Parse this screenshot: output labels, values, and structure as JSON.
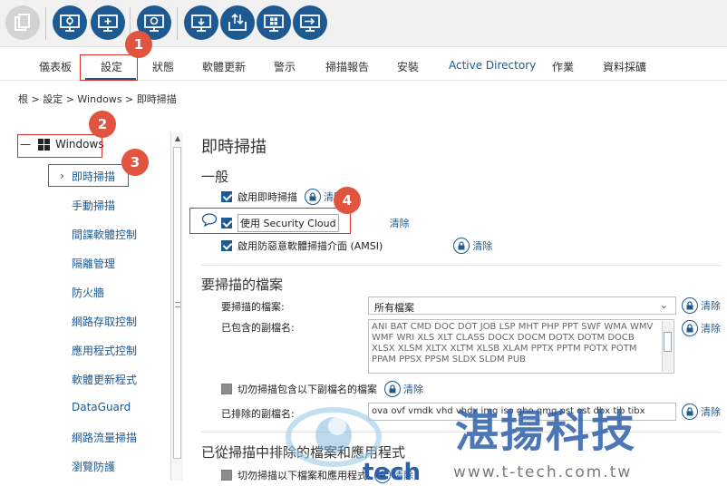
{
  "toolbar": {
    "buttons": [
      {
        "icon": "copy-icon",
        "enabled": false
      },
      {
        "icon": "monitor-settings-icon",
        "enabled": true
      },
      {
        "icon": "monitor-add-icon",
        "enabled": true
      },
      {
        "icon": "settings-monitor-icon",
        "enabled": true
      },
      {
        "icon": "monitor-download-icon",
        "enabled": true
      },
      {
        "icon": "monitor-transfer-icon",
        "enabled": true
      },
      {
        "icon": "windows-monitor-icon",
        "enabled": true
      },
      {
        "icon": "monitor-login-icon",
        "enabled": true
      }
    ]
  },
  "tabs": [
    "儀表板",
    "設定",
    "狀態",
    "軟體更新",
    "警示",
    "掃描報告",
    "安裝",
    "Active Directory",
    "作業",
    "資料採礦"
  ],
  "active_tab": "設定",
  "breadcrumb": "根 > 設定 > Windows > 即時掃描",
  "nav": {
    "root": "Windows",
    "items": [
      "即時掃描",
      "手動掃描",
      "間諜軟體控制",
      "隔離管理",
      "防火牆",
      "網路存取控制",
      "應用程式控制",
      "軟體更新程式",
      "DataGuard",
      "網路流量掃描",
      "瀏覽防護"
    ]
  },
  "main": {
    "title": "即時掃描",
    "general_title": "一般",
    "enable_realtime": "啟用即時掃描",
    "use_security_cloud": "使用 Security Cloud",
    "enable_amsi": "啟用防惡意軟體掃描介面 (AMSI)",
    "clear_label": "清除",
    "files_title": "要掃描的檔案",
    "files_label": "要掃描的檔案:",
    "files_value": "所有檔案",
    "included_ext_label": "已包含的副檔名:",
    "included_ext_value": "ANI BAT CMD DOC DOT JOB LSP MHT PHP PPT SWF WMA WMV WMF WRI XLS XLT CLASS DOCX DOCM DOTX DOTM DOCB XLSX XLSM XLTX XLTM XLSB XLAM PPTX PPTM POTX POTM PPAM PPSX PPSM SLDX SLDM PUB",
    "exclude_ext_checkbox": "切勿掃描包含以下副檔名的檔案",
    "excluded_ext_label": "已排除的副檔名:",
    "excluded_ext_value": "ova ovf vmdk vhd vhdx img iso gho qmg pst ost dbx tib tibx",
    "excluded_title": "已從掃描中排除的檔案和應用程式",
    "exclude_files_checkbox": "切勿掃描以下檔案和應用程式"
  },
  "callouts": [
    "1",
    "2",
    "3",
    "4"
  ],
  "watermark": {
    "brand": "湛揚科技",
    "url": "www.t-tech.com.tw",
    "logo_text": "tech"
  },
  "colors": {
    "primary": "#1c5a91",
    "callout": "#e1543f",
    "highlight": "#d9302a"
  }
}
